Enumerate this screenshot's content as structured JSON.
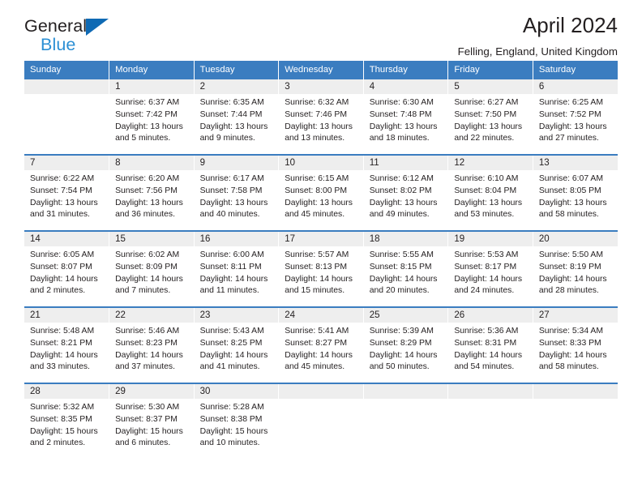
{
  "brand": {
    "name_top": "General",
    "name_bottom": "Blue",
    "triangle_color": "#0f6ab4",
    "blue_text_color": "#2b8fd4"
  },
  "header": {
    "title": "April 2024",
    "subtitle": "Felling, England, United Kingdom",
    "header_bg": "#3b7dc0",
    "daynum_bg": "#eeeeee"
  },
  "weekdays": [
    "Sunday",
    "Monday",
    "Tuesday",
    "Wednesday",
    "Thursday",
    "Friday",
    "Saturday"
  ],
  "labels": {
    "sunrise_prefix": "Sunrise: ",
    "sunset_prefix": "Sunset: ",
    "daylight_prefix": "Daylight: "
  },
  "weeks": [
    [
      {
        "day": "",
        "sunrise": "",
        "sunset": "",
        "daylight_a": "",
        "daylight_b": ""
      },
      {
        "day": "1",
        "sunrise": "Sunrise: 6:37 AM",
        "sunset": "Sunset: 7:42 PM",
        "daylight_a": "Daylight: 13 hours",
        "daylight_b": "and 5 minutes."
      },
      {
        "day": "2",
        "sunrise": "Sunrise: 6:35 AM",
        "sunset": "Sunset: 7:44 PM",
        "daylight_a": "Daylight: 13 hours",
        "daylight_b": "and 9 minutes."
      },
      {
        "day": "3",
        "sunrise": "Sunrise: 6:32 AM",
        "sunset": "Sunset: 7:46 PM",
        "daylight_a": "Daylight: 13 hours",
        "daylight_b": "and 13 minutes."
      },
      {
        "day": "4",
        "sunrise": "Sunrise: 6:30 AM",
        "sunset": "Sunset: 7:48 PM",
        "daylight_a": "Daylight: 13 hours",
        "daylight_b": "and 18 minutes."
      },
      {
        "day": "5",
        "sunrise": "Sunrise: 6:27 AM",
        "sunset": "Sunset: 7:50 PM",
        "daylight_a": "Daylight: 13 hours",
        "daylight_b": "and 22 minutes."
      },
      {
        "day": "6",
        "sunrise": "Sunrise: 6:25 AM",
        "sunset": "Sunset: 7:52 PM",
        "daylight_a": "Daylight: 13 hours",
        "daylight_b": "and 27 minutes."
      }
    ],
    [
      {
        "day": "7",
        "sunrise": "Sunrise: 6:22 AM",
        "sunset": "Sunset: 7:54 PM",
        "daylight_a": "Daylight: 13 hours",
        "daylight_b": "and 31 minutes."
      },
      {
        "day": "8",
        "sunrise": "Sunrise: 6:20 AM",
        "sunset": "Sunset: 7:56 PM",
        "daylight_a": "Daylight: 13 hours",
        "daylight_b": "and 36 minutes."
      },
      {
        "day": "9",
        "sunrise": "Sunrise: 6:17 AM",
        "sunset": "Sunset: 7:58 PM",
        "daylight_a": "Daylight: 13 hours",
        "daylight_b": "and 40 minutes."
      },
      {
        "day": "10",
        "sunrise": "Sunrise: 6:15 AM",
        "sunset": "Sunset: 8:00 PM",
        "daylight_a": "Daylight: 13 hours",
        "daylight_b": "and 45 minutes."
      },
      {
        "day": "11",
        "sunrise": "Sunrise: 6:12 AM",
        "sunset": "Sunset: 8:02 PM",
        "daylight_a": "Daylight: 13 hours",
        "daylight_b": "and 49 minutes."
      },
      {
        "day": "12",
        "sunrise": "Sunrise: 6:10 AM",
        "sunset": "Sunset: 8:04 PM",
        "daylight_a": "Daylight: 13 hours",
        "daylight_b": "and 53 minutes."
      },
      {
        "day": "13",
        "sunrise": "Sunrise: 6:07 AM",
        "sunset": "Sunset: 8:05 PM",
        "daylight_a": "Daylight: 13 hours",
        "daylight_b": "and 58 minutes."
      }
    ],
    [
      {
        "day": "14",
        "sunrise": "Sunrise: 6:05 AM",
        "sunset": "Sunset: 8:07 PM",
        "daylight_a": "Daylight: 14 hours",
        "daylight_b": "and 2 minutes."
      },
      {
        "day": "15",
        "sunrise": "Sunrise: 6:02 AM",
        "sunset": "Sunset: 8:09 PM",
        "daylight_a": "Daylight: 14 hours",
        "daylight_b": "and 7 minutes."
      },
      {
        "day": "16",
        "sunrise": "Sunrise: 6:00 AM",
        "sunset": "Sunset: 8:11 PM",
        "daylight_a": "Daylight: 14 hours",
        "daylight_b": "and 11 minutes."
      },
      {
        "day": "17",
        "sunrise": "Sunrise: 5:57 AM",
        "sunset": "Sunset: 8:13 PM",
        "daylight_a": "Daylight: 14 hours",
        "daylight_b": "and 15 minutes."
      },
      {
        "day": "18",
        "sunrise": "Sunrise: 5:55 AM",
        "sunset": "Sunset: 8:15 PM",
        "daylight_a": "Daylight: 14 hours",
        "daylight_b": "and 20 minutes."
      },
      {
        "day": "19",
        "sunrise": "Sunrise: 5:53 AM",
        "sunset": "Sunset: 8:17 PM",
        "daylight_a": "Daylight: 14 hours",
        "daylight_b": "and 24 minutes."
      },
      {
        "day": "20",
        "sunrise": "Sunrise: 5:50 AM",
        "sunset": "Sunset: 8:19 PM",
        "daylight_a": "Daylight: 14 hours",
        "daylight_b": "and 28 minutes."
      }
    ],
    [
      {
        "day": "21",
        "sunrise": "Sunrise: 5:48 AM",
        "sunset": "Sunset: 8:21 PM",
        "daylight_a": "Daylight: 14 hours",
        "daylight_b": "and 33 minutes."
      },
      {
        "day": "22",
        "sunrise": "Sunrise: 5:46 AM",
        "sunset": "Sunset: 8:23 PM",
        "daylight_a": "Daylight: 14 hours",
        "daylight_b": "and 37 minutes."
      },
      {
        "day": "23",
        "sunrise": "Sunrise: 5:43 AM",
        "sunset": "Sunset: 8:25 PM",
        "daylight_a": "Daylight: 14 hours",
        "daylight_b": "and 41 minutes."
      },
      {
        "day": "24",
        "sunrise": "Sunrise: 5:41 AM",
        "sunset": "Sunset: 8:27 PM",
        "daylight_a": "Daylight: 14 hours",
        "daylight_b": "and 45 minutes."
      },
      {
        "day": "25",
        "sunrise": "Sunrise: 5:39 AM",
        "sunset": "Sunset: 8:29 PM",
        "daylight_a": "Daylight: 14 hours",
        "daylight_b": "and 50 minutes."
      },
      {
        "day": "26",
        "sunrise": "Sunrise: 5:36 AM",
        "sunset": "Sunset: 8:31 PM",
        "daylight_a": "Daylight: 14 hours",
        "daylight_b": "and 54 minutes."
      },
      {
        "day": "27",
        "sunrise": "Sunrise: 5:34 AM",
        "sunset": "Sunset: 8:33 PM",
        "daylight_a": "Daylight: 14 hours",
        "daylight_b": "and 58 minutes."
      }
    ],
    [
      {
        "day": "28",
        "sunrise": "Sunrise: 5:32 AM",
        "sunset": "Sunset: 8:35 PM",
        "daylight_a": "Daylight: 15 hours",
        "daylight_b": "and 2 minutes."
      },
      {
        "day": "29",
        "sunrise": "Sunrise: 5:30 AM",
        "sunset": "Sunset: 8:37 PM",
        "daylight_a": "Daylight: 15 hours",
        "daylight_b": "and 6 minutes."
      },
      {
        "day": "30",
        "sunrise": "Sunrise: 5:28 AM",
        "sunset": "Sunset: 8:38 PM",
        "daylight_a": "Daylight: 15 hours",
        "daylight_b": "and 10 minutes."
      },
      {
        "day": "",
        "sunrise": "",
        "sunset": "",
        "daylight_a": "",
        "daylight_b": ""
      },
      {
        "day": "",
        "sunrise": "",
        "sunset": "",
        "daylight_a": "",
        "daylight_b": ""
      },
      {
        "day": "",
        "sunrise": "",
        "sunset": "",
        "daylight_a": "",
        "daylight_b": ""
      },
      {
        "day": "",
        "sunrise": "",
        "sunset": "",
        "daylight_a": "",
        "daylight_b": ""
      }
    ]
  ]
}
